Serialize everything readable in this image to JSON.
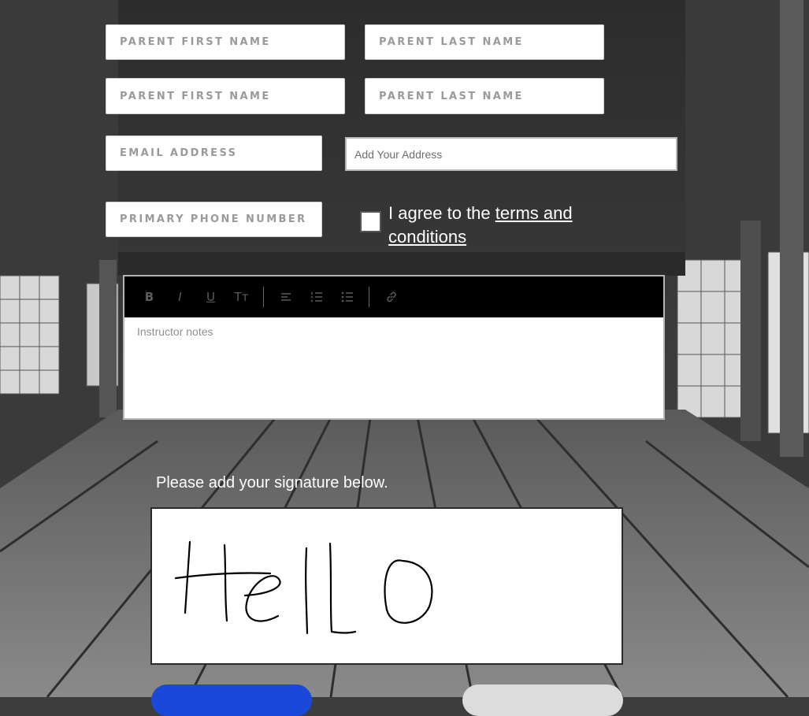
{
  "form": {
    "parent1_first_placeholder": "PARENT FIRST NAME",
    "parent1_last_placeholder": "PARENT LAST NAME",
    "parent2_first_placeholder": "PARENT FIRST NAME",
    "parent2_last_placeholder": "PARENT LAST NAME",
    "email_placeholder": "EMAIL ADDRESS",
    "address_placeholder": "Add Your Address",
    "phone_placeholder": "PRIMARY PHONE NUMBER"
  },
  "terms": {
    "checked": false,
    "prefix": "I agree to the ",
    "link_text": "terms and conditions"
  },
  "editor": {
    "toolbar": {
      "bold": "B",
      "italic": "I",
      "underline": "U",
      "text_size": "Tт"
    },
    "placeholder": "Instructor notes"
  },
  "signature": {
    "label": "Please add your signature below."
  },
  "colors": {
    "primary_button": "#1a48d8",
    "secondary_button": "#dcdcdc",
    "toolbar_bg": "#000000"
  }
}
